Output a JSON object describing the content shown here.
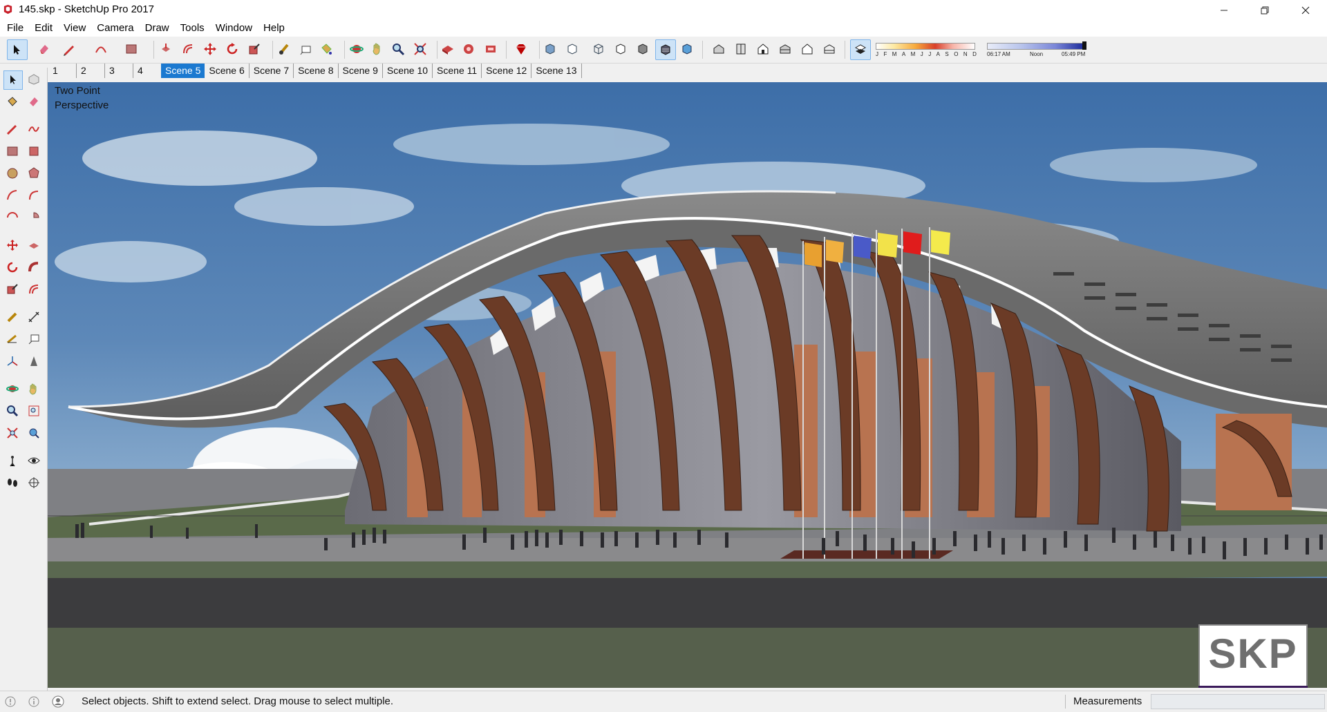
{
  "window": {
    "title": "145.skp - SketchUp Pro 2017"
  },
  "menu": {
    "items": [
      "File",
      "Edit",
      "View",
      "Camera",
      "Draw",
      "Tools",
      "Window",
      "Help"
    ]
  },
  "shadow_settings": {
    "months": [
      "J",
      "F",
      "M",
      "A",
      "M",
      "J",
      "J",
      "A",
      "S",
      "O",
      "N",
      "D"
    ],
    "time_start": "06:17 AM",
    "time_noon": "Noon",
    "time_end": "05:49 PM"
  },
  "scenes": {
    "tabs": [
      "1",
      "2",
      "3",
      "4",
      "Scene 5",
      "Scene 6",
      "Scene 7",
      "Scene 8",
      "Scene 9",
      "Scene 10",
      "Scene 11",
      "Scene 12",
      "Scene 13"
    ],
    "active": "Scene 5"
  },
  "viewport": {
    "camera_label_line1": "Two Point",
    "camera_label_line2": "Perspective",
    "badge": "SKP"
  },
  "status": {
    "message": "Select objects. Shift to extend select. Drag mouse to select multiple.",
    "measurements_label": "Measurements",
    "measurements_value": ""
  },
  "colors": {
    "active_tab": "#1b79d0",
    "sky": "#5b82ae",
    "roof": "#7e7e7e",
    "fin_wood": "#6b3b26",
    "panel_orange": "#b87350",
    "grass": "#5a6a4a",
    "road": "#3a3a3a"
  },
  "icons": {
    "app": "sketchup-logo-icon",
    "minimize": "minimize-icon",
    "maximize": "restore-icon",
    "close": "close-icon"
  }
}
